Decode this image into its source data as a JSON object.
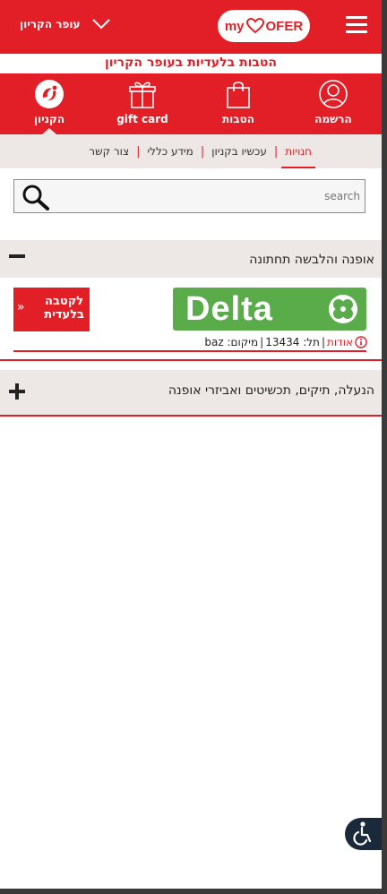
{
  "header": {
    "logo_my": "my",
    "logo_brand": "OFER",
    "mall_name": "עופר הקריון",
    "subtitle": "הטבות בלעדיות בעופר הקריון"
  },
  "nav": {
    "items": [
      {
        "label": "הרשמה",
        "icon": "user-icon"
      },
      {
        "label": "הטבות",
        "icon": "shopping-bag-icon"
      },
      {
        "label": "gift card",
        "icon": "gift-icon"
      },
      {
        "label": "הקניון",
        "icon": "mall-icon",
        "active": true
      }
    ]
  },
  "subtabs": {
    "items": [
      "חנויות",
      "עכשיו בקניון",
      "מידע כללי",
      "צור קשר"
    ],
    "active": "חנויות"
  },
  "search": {
    "placeholder": "search"
  },
  "categories": [
    {
      "title": "אופנה והלבשה תחתונה",
      "expanded": true
    },
    {
      "title": "הנעלה, תיקים, תכשיטים ואביזרי אופנה",
      "expanded": false
    }
  ],
  "store": {
    "logo_text": "Delta",
    "deal_line1": "לקטבה",
    "deal_line2": "בלעדית",
    "deal_chevron": "»",
    "about": "אודות",
    "phone": "תל: 13434",
    "location": "מיקום: baz"
  },
  "colors": {
    "brand_red": "#e21f26",
    "light_bg": "#ede8e6",
    "delta_green": "#5aab4a"
  }
}
